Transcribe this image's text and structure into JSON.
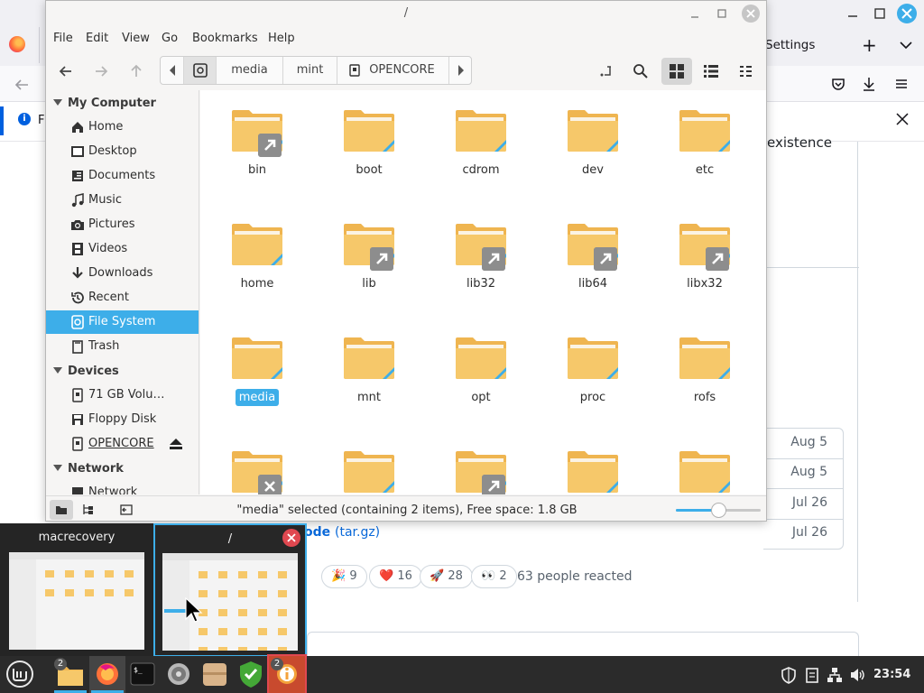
{
  "firefox": {
    "tab_settings": "Settings",
    "new_tab_label": "+",
    "notification_letter": "F",
    "page_text_existence": "existence",
    "asset_dates": [
      "Aug 5",
      "Aug 5",
      "Jul 26",
      "Jul 26"
    ],
    "code_link": "ode",
    "code_ext": "(tar.gz)",
    "reactions": [
      {
        "emoji": "🎉",
        "count": "9"
      },
      {
        "emoji": "❤️",
        "count": "16"
      },
      {
        "emoji": "🚀",
        "count": "28"
      },
      {
        "emoji": "👀",
        "count": "2"
      }
    ],
    "reactions_summary": "63 people reacted"
  },
  "nemo": {
    "title": "/",
    "menu": [
      "File",
      "Edit",
      "View",
      "Go",
      "Bookmarks",
      "Help"
    ],
    "path": [
      "media",
      "mint",
      "OPENCORE"
    ],
    "sidebar": {
      "my_computer": {
        "header": "My Computer",
        "items": [
          {
            "label": "Home",
            "icon": "home-icon"
          },
          {
            "label": "Desktop",
            "icon": "desktop-icon"
          },
          {
            "label": "Documents",
            "icon": "documents-icon"
          },
          {
            "label": "Music",
            "icon": "music-icon"
          },
          {
            "label": "Pictures",
            "icon": "camera-icon"
          },
          {
            "label": "Videos",
            "icon": "film-icon"
          },
          {
            "label": "Downloads",
            "icon": "download-icon"
          },
          {
            "label": "Recent",
            "icon": "recent-icon"
          },
          {
            "label": "File System",
            "icon": "filesystem-icon",
            "selected": true
          },
          {
            "label": "Trash",
            "icon": "trash-icon"
          }
        ]
      },
      "devices": {
        "header": "Devices",
        "items": [
          {
            "label": "71 GB Volu…",
            "icon": "drive-icon"
          },
          {
            "label": "Floppy Disk",
            "icon": "floppy-icon"
          },
          {
            "label": "OPENCORE",
            "icon": "drive-icon",
            "ejectable": true
          }
        ]
      },
      "network": {
        "header": "Network",
        "items": [
          {
            "label": "Network",
            "icon": "network-icon"
          }
        ]
      }
    },
    "files": [
      {
        "name": "bin",
        "symlink": true
      },
      {
        "name": "boot",
        "symlink": false
      },
      {
        "name": "cdrom",
        "symlink": false
      },
      {
        "name": "dev",
        "symlink": false
      },
      {
        "name": "etc",
        "symlink": false
      },
      {
        "name": "home",
        "symlink": false
      },
      {
        "name": "lib",
        "symlink": true
      },
      {
        "name": "lib32",
        "symlink": true
      },
      {
        "name": "lib64",
        "symlink": true
      },
      {
        "name": "libx32",
        "symlink": true
      },
      {
        "name": "media",
        "symlink": false,
        "selected": true
      },
      {
        "name": "mnt",
        "symlink": false
      },
      {
        "name": "opt",
        "symlink": false
      },
      {
        "name": "proc",
        "symlink": false
      },
      {
        "name": "rofs",
        "symlink": false
      },
      {
        "name": "",
        "symlink": false,
        "unreadable": true
      },
      {
        "name": "",
        "symlink": false
      },
      {
        "name": "",
        "symlink": true
      },
      {
        "name": "",
        "symlink": false
      },
      {
        "name": "",
        "symlink": false
      }
    ],
    "status_text": "\"media\" selected (containing 2 items), Free space: 1.8 GB",
    "zoom_level": 0.5
  },
  "switcher": {
    "windows": [
      {
        "title": "macrecovery",
        "active": false
      },
      {
        "title": "/",
        "active": true
      }
    ]
  },
  "taskbar": {
    "apps": [
      {
        "name": "files",
        "badge": "2"
      },
      {
        "name": "firefox",
        "badge": ""
      },
      {
        "name": "terminal",
        "badge": ""
      },
      {
        "name": "disks",
        "badge": ""
      },
      {
        "name": "archive-manager",
        "badge": ""
      },
      {
        "name": "update-manager",
        "badge": ""
      },
      {
        "name": "system-reports",
        "badge": "2"
      }
    ],
    "clock": "23:54"
  },
  "colors": {
    "accent": "#3daee9",
    "folder": "#f6c86a",
    "folder_dark": "#efb550",
    "taskbar": "#2b2b2b"
  }
}
